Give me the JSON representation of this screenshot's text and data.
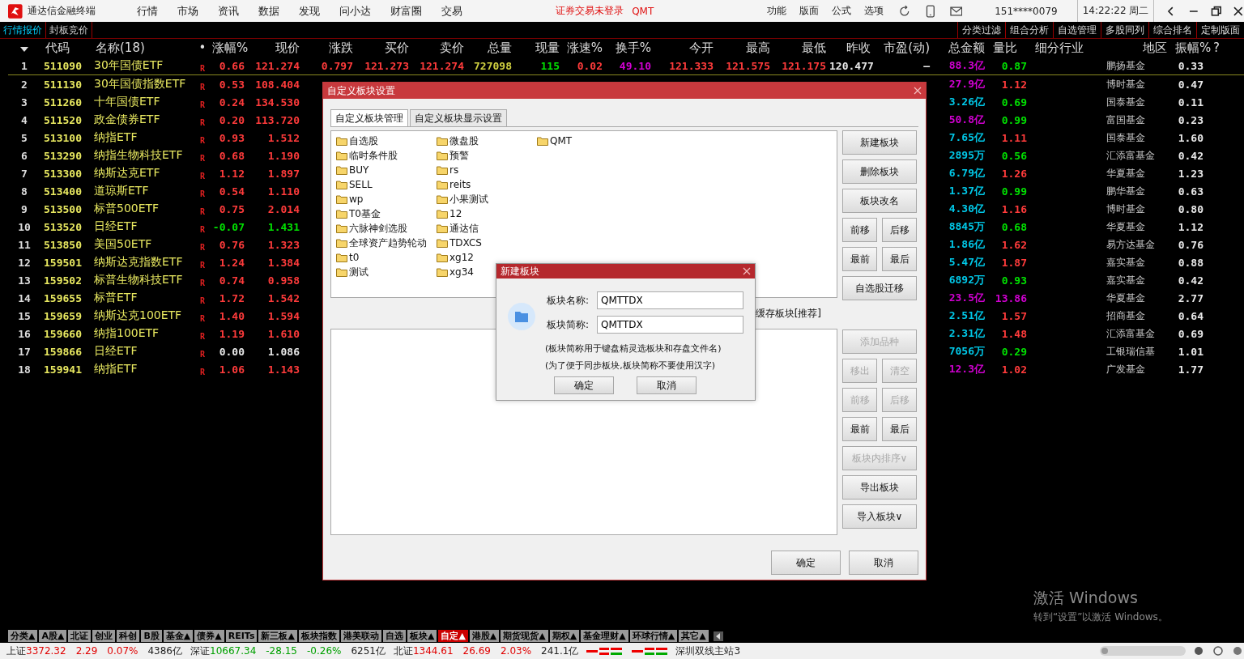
{
  "title_bar": {
    "app_name": "通达信金融终端",
    "menu": [
      "行情",
      "市场",
      "资讯",
      "数据",
      "发现",
      "问小达",
      "财富圈",
      "交易"
    ],
    "notice": "证券交易未登录",
    "notice_tag": "QMT",
    "tools": [
      "功能",
      "版面",
      "公式",
      "选项"
    ],
    "account": "151****0079",
    "clock": "14:22:22 周二"
  },
  "view_tabs": [
    {
      "label": "行情报价",
      "selected": true
    },
    {
      "label": "封板竞价",
      "selected": false
    }
  ],
  "view_buttons": [
    "分类过滤",
    "组合分析",
    "自选管理",
    "多股同列",
    "综合排名",
    "定制版面"
  ],
  "table": {
    "columns": [
      "代码",
      "名称(18)",
      "•",
      "涨幅%",
      "现价",
      "涨跌",
      "买价",
      "卖价",
      "总量",
      "现量",
      "涨速%",
      "换手%",
      "今开",
      "最高",
      "最低",
      "昨收",
      "市盈(动)",
      "总金额",
      "量比",
      "细分行业",
      "地区",
      "振幅%",
      "?"
    ],
    "rows": [
      {
        "no": "1",
        "selected": true,
        "left_cells": [
          "511090",
          "30年国债ETF",
          "R",
          {
            "text": "0.66",
            "color": "#ff3b3b"
          },
          {
            "text": "121.274",
            "color": "#ff3b3b"
          }
        ],
        "middle_cells": [
          {
            "text": "0.797",
            "color": "#ff3b3b"
          },
          {
            "text": "121.273",
            "color": "#ff3b3b"
          },
          {
            "text": "121.274",
            "color": "#ff3b3b"
          },
          {
            "text": "727098",
            "color": "#d0d040"
          },
          {
            "text": "115",
            "color": "#00e000"
          },
          {
            "text": "0.02",
            "color": "#ff3b3b"
          },
          {
            "text": "49.10",
            "color": "#d000d0"
          },
          {
            "text": "121.333",
            "color": "#ff3b3b"
          },
          {
            "text": "121.575",
            "color": "#ff3b3b"
          },
          {
            "text": "121.175",
            "color": "#ff3b3b"
          },
          {
            "text": "120.477",
            "color": "#e8e8e8"
          },
          {
            "text": "–",
            "color": "#e8e8e8"
          }
        ],
        "right_cells": [
          {
            "text": "88.3亿",
            "color": "#d000d0"
          },
          {
            "text": "0.87",
            "color": "#00e000"
          },
          "鹏扬基金",
          {
            "text": "0.33",
            "color": "#e8e8e8"
          }
        ]
      },
      {
        "no": "2",
        "selected": false,
        "left_cells": [
          "511130",
          "30年国债指数ETF",
          "R",
          {
            "text": "0.53",
            "color": "#ff3b3b"
          },
          {
            "text": "108.404",
            "color": "#ff3b3b"
          }
        ],
        "right_cells": [
          {
            "text": "27.9亿",
            "color": "#d000d0"
          },
          {
            "text": "1.12",
            "color": "#ff3b3b"
          },
          "博时基金",
          {
            "text": "0.47",
            "color": "#e8e8e8"
          }
        ]
      },
      {
        "no": "3",
        "selected": false,
        "left_cells": [
          "511260",
          "十年国债ETF",
          "R",
          {
            "text": "0.24",
            "color": "#ff3b3b"
          },
          {
            "text": "134.530",
            "color": "#ff3b3b"
          }
        ],
        "right_cells": [
          {
            "text": "3.26亿",
            "color": "#00c8e8"
          },
          {
            "text": "0.69",
            "color": "#00e000"
          },
          "国泰基金",
          {
            "text": "0.11",
            "color": "#e8e8e8"
          }
        ]
      },
      {
        "no": "4",
        "selected": false,
        "left_cells": [
          "511520",
          "政金债券ETF",
          "R",
          {
            "text": "0.20",
            "color": "#ff3b3b"
          },
          {
            "text": "113.720",
            "color": "#ff3b3b"
          }
        ],
        "right_cells": [
          {
            "text": "50.8亿",
            "color": "#d000d0"
          },
          {
            "text": "0.99",
            "color": "#00e000"
          },
          "富国基金",
          {
            "text": "0.23",
            "color": "#e8e8e8"
          }
        ]
      },
      {
        "no": "5",
        "selected": false,
        "left_cells": [
          "513100",
          "纳指ETF",
          "R",
          {
            "text": "0.93",
            "color": "#ff3b3b"
          },
          {
            "text": "1.512",
            "color": "#ff3b3b"
          }
        ],
        "right_cells": [
          {
            "text": "7.65亿",
            "color": "#00c8e8"
          },
          {
            "text": "1.11",
            "color": "#ff3b3b"
          },
          "国泰基金",
          {
            "text": "1.60",
            "color": "#e8e8e8"
          }
        ]
      },
      {
        "no": "6",
        "selected": false,
        "left_cells": [
          "513290",
          "纳指生物科技ETF",
          "R",
          {
            "text": "0.68",
            "color": "#ff3b3b"
          },
          {
            "text": "1.190",
            "color": "#ff3b3b"
          }
        ],
        "right_cells": [
          {
            "text": "2895万",
            "color": "#00c8e8"
          },
          {
            "text": "0.56",
            "color": "#00e000"
          },
          "汇添富基金",
          {
            "text": "0.42",
            "color": "#e8e8e8"
          }
        ]
      },
      {
        "no": "7",
        "selected": false,
        "left_cells": [
          "513300",
          "纳斯达克ETF",
          "R",
          {
            "text": "1.12",
            "color": "#ff3b3b"
          },
          {
            "text": "1.897",
            "color": "#ff3b3b"
          }
        ],
        "right_cells": [
          {
            "text": "6.79亿",
            "color": "#00c8e8"
          },
          {
            "text": "1.26",
            "color": "#ff3b3b"
          },
          "华夏基金",
          {
            "text": "1.23",
            "color": "#e8e8e8"
          }
        ]
      },
      {
        "no": "8",
        "selected": false,
        "left_cells": [
          "513400",
          "道琼斯ETF",
          "R",
          {
            "text": "0.54",
            "color": "#ff3b3b"
          },
          {
            "text": "1.110",
            "color": "#ff3b3b"
          }
        ],
        "right_cells": [
          {
            "text": "1.37亿",
            "color": "#00c8e8"
          },
          {
            "text": "0.99",
            "color": "#00e000"
          },
          "鹏华基金",
          {
            "text": "0.63",
            "color": "#e8e8e8"
          }
        ]
      },
      {
        "no": "9",
        "selected": false,
        "left_cells": [
          "513500",
          "标普500ETF",
          "R",
          {
            "text": "0.75",
            "color": "#ff3b3b"
          },
          {
            "text": "2.014",
            "color": "#ff3b3b"
          }
        ],
        "right_cells": [
          {
            "text": "4.30亿",
            "color": "#00c8e8"
          },
          {
            "text": "1.16",
            "color": "#ff3b3b"
          },
          "博时基金",
          {
            "text": "0.80",
            "color": "#e8e8e8"
          }
        ]
      },
      {
        "no": "10",
        "selected": false,
        "left_cells": [
          "513520",
          "日经ETF",
          "R",
          {
            "text": "-0.07",
            "color": "#00e000"
          },
          {
            "text": "1.431",
            "color": "#00e000"
          }
        ],
        "right_cells": [
          {
            "text": "8845万",
            "color": "#00c8e8"
          },
          {
            "text": "0.68",
            "color": "#00e000"
          },
          "华夏基金",
          {
            "text": "1.12",
            "color": "#e8e8e8"
          }
        ]
      },
      {
        "no": "11",
        "selected": false,
        "left_cells": [
          "513850",
          "美国50ETF",
          "R",
          {
            "text": "0.76",
            "color": "#ff3b3b"
          },
          {
            "text": "1.323",
            "color": "#ff3b3b"
          }
        ],
        "right_cells": [
          {
            "text": "1.86亿",
            "color": "#00c8e8"
          },
          {
            "text": "1.62",
            "color": "#ff3b3b"
          },
          "易方达基金",
          {
            "text": "0.76",
            "color": "#e8e8e8"
          }
        ]
      },
      {
        "no": "12",
        "selected": false,
        "left_cells": [
          "159501",
          "纳斯达克指数ETF",
          "R",
          {
            "text": "1.24",
            "color": "#ff3b3b"
          },
          {
            "text": "1.384",
            "color": "#ff3b3b"
          }
        ],
        "right_cells": [
          {
            "text": "5.47亿",
            "color": "#00c8e8"
          },
          {
            "text": "1.87",
            "color": "#ff3b3b"
          },
          "嘉实基金",
          {
            "text": "0.88",
            "color": "#e8e8e8"
          }
        ]
      },
      {
        "no": "13",
        "selected": false,
        "left_cells": [
          "159502",
          "标普生物科技ETF",
          "R",
          {
            "text": "0.74",
            "color": "#ff3b3b"
          },
          {
            "text": "0.958",
            "color": "#ff3b3b"
          }
        ],
        "right_cells": [
          {
            "text": "6892万",
            "color": "#00c8e8"
          },
          {
            "text": "0.93",
            "color": "#00e000"
          },
          "嘉实基金",
          {
            "text": "0.42",
            "color": "#e8e8e8"
          }
        ]
      },
      {
        "no": "14",
        "selected": false,
        "left_cells": [
          "159655",
          "标普ETF",
          "R",
          {
            "text": "1.72",
            "color": "#ff3b3b"
          },
          {
            "text": "1.542",
            "color": "#ff3b3b"
          }
        ],
        "right_cells": [
          {
            "text": "23.5亿",
            "color": "#d000d0"
          },
          {
            "text": "13.86",
            "color": "#d000d0"
          },
          "华夏基金",
          {
            "text": "2.77",
            "color": "#e8e8e8"
          }
        ]
      },
      {
        "no": "15",
        "selected": false,
        "left_cells": [
          "159659",
          "纳斯达克100ETF",
          "R",
          {
            "text": "1.40",
            "color": "#ff3b3b"
          },
          {
            "text": "1.594",
            "color": "#ff3b3b"
          }
        ],
        "right_cells": [
          {
            "text": "2.51亿",
            "color": "#00c8e8"
          },
          {
            "text": "1.57",
            "color": "#ff3b3b"
          },
          "招商基金",
          {
            "text": "0.64",
            "color": "#e8e8e8"
          }
        ]
      },
      {
        "no": "16",
        "selected": false,
        "left_cells": [
          "159660",
          "纳指100ETF",
          "R",
          {
            "text": "1.19",
            "color": "#ff3b3b"
          },
          {
            "text": "1.610",
            "color": "#ff3b3b"
          }
        ],
        "right_cells": [
          {
            "text": "2.31亿",
            "color": "#00c8e8"
          },
          {
            "text": "1.48",
            "color": "#ff3b3b"
          },
          "汇添富基金",
          {
            "text": "0.69",
            "color": "#e8e8e8"
          }
        ]
      },
      {
        "no": "17",
        "selected": false,
        "left_cells": [
          "159866",
          "日经ETF",
          "R",
          {
            "text": "0.00",
            "color": "#e8e8e8"
          },
          {
            "text": "1.086",
            "color": "#e8e8e8"
          }
        ],
        "right_cells": [
          {
            "text": "7056万",
            "color": "#00c8e8"
          },
          {
            "text": "0.29",
            "color": "#00e000"
          },
          "工银瑞信基",
          {
            "text": "1.01",
            "color": "#e8e8e8"
          }
        ]
      },
      {
        "no": "18",
        "selected": false,
        "left_cells": [
          "159941",
          "纳指ETF",
          "R",
          {
            "text": "1.06",
            "color": "#ff3b3b"
          },
          {
            "text": "1.143",
            "color": "#ff3b3b"
          }
        ],
        "right_cells": [
          {
            "text": "12.3亿",
            "color": "#d000d0"
          },
          {
            "text": "1.02",
            "color": "#ff3b3b"
          },
          "广发基金",
          {
            "text": "1.77",
            "color": "#e8e8e8"
          }
        ]
      }
    ]
  },
  "dialog": {
    "title": "自定义板块设置",
    "tabs": [
      {
        "label": "自定义板块管理",
        "selected": true
      },
      {
        "label": "自定义板块显示设置",
        "selected": false
      }
    ],
    "folders": [
      "自选股",
      "临时条件股",
      "BUY",
      "SELL",
      "wp",
      "T0基金",
      "六脉神剑选股",
      "全球资产趋势轮动",
      "t0",
      "测试",
      "微盘股",
      "预警",
      "rs",
      "reits",
      "小果测试",
      "12",
      "通达信",
      "TDXCS",
      "xg12",
      "xg34",
      "QMT"
    ],
    "cache_option": "缓存板块[推荐]",
    "upper_buttons": [
      [
        {
          "label": "新建板块",
          "disabled": false
        }
      ],
      [
        {
          "label": "删除板块",
          "disabled": false
        }
      ],
      [
        {
          "label": "板块改名",
          "disabled": false
        }
      ],
      [
        {
          "label": "前移",
          "disabled": false
        },
        {
          "label": "后移",
          "disabled": false
        }
      ],
      [
        {
          "label": "最前",
          "disabled": false
        },
        {
          "label": "最后",
          "disabled": false
        }
      ],
      [
        {
          "label": "自选股迁移",
          "disabled": false
        }
      ]
    ],
    "lower_buttons": [
      [
        {
          "label": "添加品种",
          "disabled": true
        }
      ],
      [
        {
          "label": "移出",
          "disabled": true
        },
        {
          "label": "清空",
          "disabled": true
        }
      ],
      [
        {
          "label": "前移",
          "disabled": true
        },
        {
          "label": "后移",
          "disabled": true
        }
      ],
      [
        {
          "label": "最前",
          "disabled": false
        },
        {
          "label": "最后",
          "disabled": false
        }
      ],
      [
        {
          "label": "板块内排序∨",
          "disabled": true
        }
      ],
      [
        {
          "label": "导出板块",
          "disabled": false
        }
      ],
      [
        {
          "label": "导入板块∨",
          "disabled": false
        }
      ]
    ],
    "ok": "确定",
    "cancel": "取消",
    "new_block": {
      "title": "新建板块",
      "fields": [
        {
          "label": "板块名称:",
          "value": "QMTTDX"
        },
        {
          "label": "板块简称:",
          "value": "QMTTDX"
        }
      ],
      "notes": [
        "(板块简称用于键盘精灵选板块和存盘文件名)",
        "(为了便于同步板块,板块简称不要使用汉字)"
      ],
      "ok": "确定",
      "cancel": "取消"
    }
  },
  "sheet_tabs": [
    {
      "label": "分类▲",
      "selected": false
    },
    {
      "label": "A股▲",
      "selected": false
    },
    {
      "label": "北证",
      "selected": false
    },
    {
      "label": "创业",
      "selected": false
    },
    {
      "label": "科创",
      "selected": false
    },
    {
      "label": "B股",
      "selected": false
    },
    {
      "label": "基金▲",
      "selected": false
    },
    {
      "label": "债券▲",
      "selected": false
    },
    {
      "label": "REITs",
      "selected": false
    },
    {
      "label": "新三板▲",
      "selected": false
    },
    {
      "label": "板块指数",
      "selected": false
    },
    {
      "label": "港美联动",
      "selected": false
    },
    {
      "label": "自选",
      "selected": false
    },
    {
      "label": "板块▲",
      "selected": false
    },
    {
      "label": "自定▲",
      "selected": true
    },
    {
      "label": "港股▲",
      "selected": false
    },
    {
      "label": "期货现货▲",
      "selected": false
    },
    {
      "label": "期权▲",
      "selected": false
    },
    {
      "label": "基金理财▲",
      "selected": false
    },
    {
      "label": "环球行情▲",
      "selected": false
    },
    {
      "label": "其它▲",
      "selected": false
    }
  ],
  "status_bar": {
    "indices": [
      {
        "name": "上证",
        "value": "3372.32",
        "change": "2.29",
        "percent": "0.07%",
        "amount": "4386亿",
        "color": "#e00000"
      },
      {
        "name": "深证",
        "value": "10667.34",
        "change": "-28.15",
        "percent": "-0.26%",
        "amount": "6251亿",
        "color": "#00a000"
      },
      {
        "name": "北证",
        "value": "1344.61",
        "change": "26.69",
        "percent": "2.03%",
        "amount": "241.1亿",
        "color": "#e00000"
      }
    ],
    "server": "深圳双线主站3"
  },
  "os_notice": {
    "title": "激活 Windows",
    "hint": "转到“设置”以激活 Windows。"
  }
}
